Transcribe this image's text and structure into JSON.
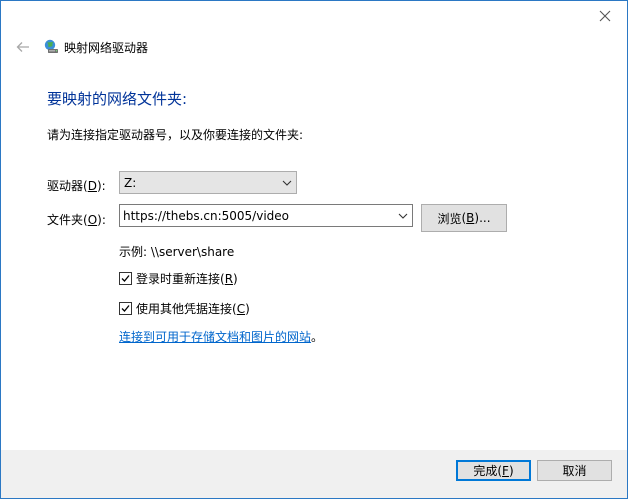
{
  "window": {
    "title": "映射网络驱动器"
  },
  "page": {
    "heading": "要映射的网络文件夹:",
    "instruction": "请为连接指定驱动器号，以及你要连接的文件夹:"
  },
  "drive": {
    "label": "驱动器",
    "accel": "D",
    "value": "Z:"
  },
  "folder": {
    "label": "文件夹",
    "accel": "O",
    "value": "https://thebs.cn:5005/video",
    "browse_label": "浏览",
    "browse_accel": "B",
    "browse_suffix": "..."
  },
  "example": "示例: \\\\server\\share",
  "options": {
    "reconnect": {
      "label": "登录时重新连接",
      "accel": "R",
      "checked": true
    },
    "credentials": {
      "label": "使用其他凭据连接",
      "accel": "C",
      "checked": true
    }
  },
  "link": {
    "text": "连接到可用于存储文档和图片的网站",
    "suffix": "。"
  },
  "footer": {
    "finish_label": "完成",
    "finish_accel": "F",
    "cancel_label": "取消"
  },
  "colors": {
    "heading": "#003399",
    "link": "#0066cc",
    "primary_border": "#0078d7",
    "window_border": "#2b78c4"
  }
}
